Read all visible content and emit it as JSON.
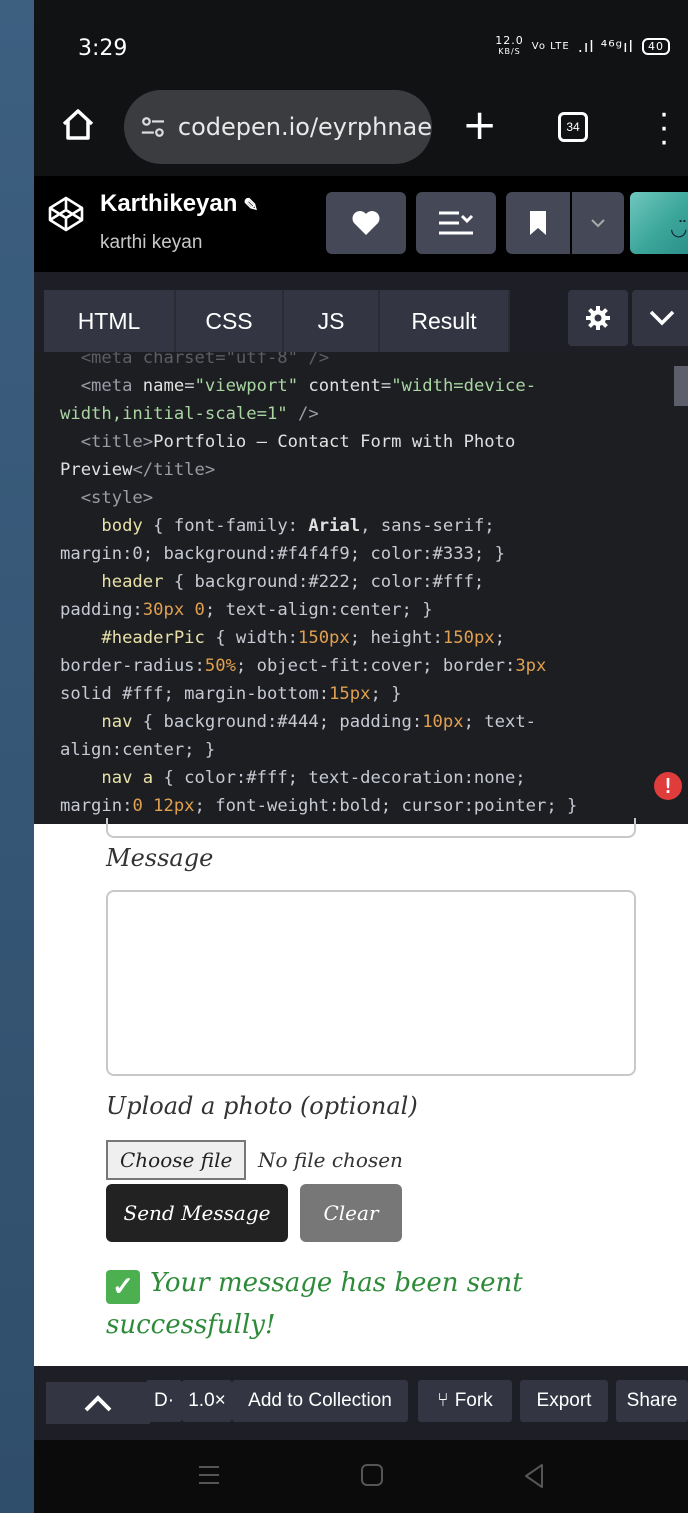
{
  "status_bar": {
    "time": "3:29",
    "speed": "12.0",
    "speed_unit": "KB/S",
    "network": "Vo LTE",
    "signal": ".ıl ⁴⁶ᵍıl",
    "battery": "40"
  },
  "browser": {
    "url": "codepen.io/eyrphnae",
    "tab_count": "34"
  },
  "codepen": {
    "author": "Karthikeyan",
    "username": "karthi keyan"
  },
  "tabs": [
    "HTML",
    "CSS",
    "JS",
    "Result"
  ],
  "code": {
    "l0": "  <meta charset=\"utf-8\" />",
    "l1a": "  <meta ",
    "l1b": "name",
    "l1c": "=",
    "l1d": "\"viewport\"",
    "l1e": " content",
    "l1f": "=",
    "l1g": "\"width=device-",
    "l2a": "width,initial-scale=1\"",
    "l2b": " />",
    "l3a": "  <title>",
    "l3b": "Portfolio — Contact Form with Photo",
    "l4a": "Preview",
    "l4b": "</title>",
    "l5": "  <style>",
    "l6a": "    body",
    "l6b": " { font-family: ",
    "l6c": "Arial",
    "l6d": ", sans-serif;",
    "l7": "margin:0; background:#f4f4f9; color:#333; }",
    "l8a": "    header",
    "l8b": " { background:#222; color:#fff;",
    "l9a": "padding:",
    "l9b": "30px 0",
    "l9c": "; text-align:center; }",
    "l10a": "    #headerPic",
    "l10b": " { width:",
    "l10c": "150px",
    "l10d": "; height:",
    "l10e": "150px",
    "l10f": ";",
    "l11a": "border-radius:",
    "l11b": "50%",
    "l11c": "; object-fit:cover; border:",
    "l11d": "3px",
    "l12a": "solid #fff",
    "l12b": "; margin-bottom:",
    "l12c": "15px",
    "l12d": "; }",
    "l13a": "    nav",
    "l13b": " { background:#444; padding:",
    "l13c": "10px",
    "l13d": "; text-",
    "l14": "align:center; }",
    "l15a": "    nav a",
    "l15b": " { color:#fff; text-decoration:none;",
    "l16a": "margin:",
    "l16b": "0 12px",
    "l16c": "; font-weight:bold; cursor:pointer; }"
  },
  "result": {
    "message_label": "Message",
    "upload_label": "Upload a photo (optional)",
    "choose_file": "Choose file",
    "no_file": "No file chosen",
    "send": "Send Message",
    "clear": "Clear",
    "success": "Your message has been sent successfully!"
  },
  "toolbar": {
    "d": "D·",
    "zoom": "1.0×",
    "add_collection": "Add to Collection",
    "fork": "Fork",
    "export": "Export",
    "share": "Share"
  },
  "colors": {
    "editor_bg": "#1d1e22",
    "button_bg": "#444857",
    "success": "#2e8b3a"
  }
}
